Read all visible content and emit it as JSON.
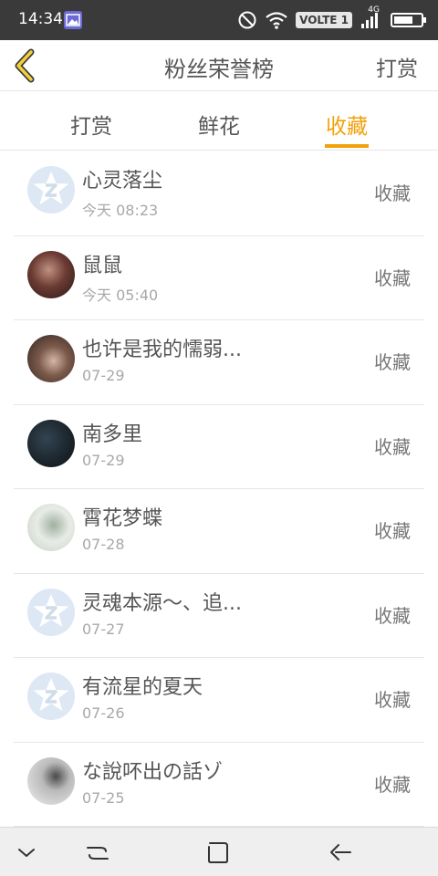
{
  "status_bar": {
    "time": "14:34",
    "volte": "VOLTE 1",
    "network": "4G",
    "icons": [
      "gallery-icon",
      "do-not-disturb-icon",
      "wifi-icon",
      "signal-icon",
      "battery-icon"
    ]
  },
  "header": {
    "back_icon": "chevron-left-icon",
    "title": "粉丝荣誉榜",
    "right_button": "打赏"
  },
  "tabs": [
    {
      "label": "打赏",
      "active": false
    },
    {
      "label": "鲜花",
      "active": false
    },
    {
      "label": "收藏",
      "active": true
    }
  ],
  "colors": {
    "accent": "#f2a20a",
    "status_bar": "#3a3a3a",
    "divider": "#e6e6e6",
    "default_avatar": "#dde8f4"
  },
  "list": [
    {
      "name": "心灵落尘",
      "time": "今天 08:23",
      "tag": "收藏",
      "avatar": "default-avatar-icon"
    },
    {
      "name": "鼠鼠",
      "time": "今天 05:40",
      "tag": "收藏",
      "avatar": "photo"
    },
    {
      "name": "也许是我的懦弱...",
      "time": "07-29",
      "tag": "收藏",
      "avatar": "photo"
    },
    {
      "name": "南多里",
      "time": "07-29",
      "tag": "收藏",
      "avatar": "photo"
    },
    {
      "name": "霄花梦蝶",
      "time": "07-28",
      "tag": "收藏",
      "avatar": "photo"
    },
    {
      "name": "灵魂本源～、追...",
      "time": "07-27",
      "tag": "收藏",
      "avatar": "default-avatar-icon"
    },
    {
      "name": "有流星的夏天",
      "time": "07-26",
      "tag": "收藏",
      "avatar": "default-avatar-icon"
    },
    {
      "name": "な說吥出の話ゾ",
      "time": "07-25",
      "tag": "收藏",
      "avatar": "photo"
    }
  ],
  "nav_bar": {
    "icons": [
      "collapse-icon",
      "menu-icon",
      "home-icon",
      "back-icon"
    ]
  }
}
